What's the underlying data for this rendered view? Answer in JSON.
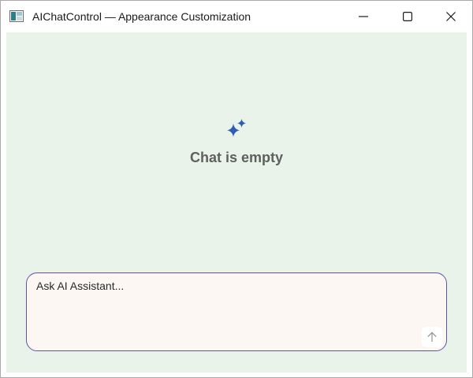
{
  "window": {
    "title": "AIChatControl — Appearance Customization",
    "controls": {
      "minimize": "minimize-icon",
      "maximize": "maximize-icon",
      "close": "close-icon"
    }
  },
  "chat": {
    "empty_icon": "sparkle-icon",
    "empty_text": "Chat is empty"
  },
  "input": {
    "placeholder": "Ask AI Assistant...",
    "value": "",
    "send_icon": "arrow-up-icon"
  },
  "colors": {
    "background": "#e9f3ea",
    "accent": "#2d5db4",
    "input_border": "#5a55a3",
    "input_background": "#fdf7f3",
    "empty_text": "#5f5f5f"
  }
}
